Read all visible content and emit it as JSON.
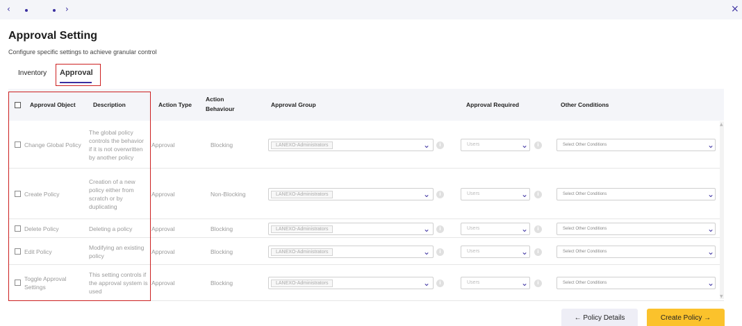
{
  "nav": {
    "prev": "‹",
    "next": "›",
    "close": "×"
  },
  "header": {
    "title": "Approval Setting",
    "subtitle": "Configure specific settings to achieve granular control"
  },
  "tabs": [
    {
      "label": "Inventory"
    },
    {
      "label": "Approval"
    }
  ],
  "table": {
    "headers": {
      "object": "Approval Object",
      "description": "Description",
      "action_type": "Action Type",
      "action_behaviour_1": "Action",
      "action_behaviour_2": "Behaviour",
      "approval_group": "Approval Group",
      "approval_required": "Approval Required",
      "other_conditions": "Other Conditions"
    },
    "rows": [
      {
        "object": [
          "Change Global Policy"
        ],
        "description": [
          "The global policy",
          "controls the behavior",
          "if it is not overwritten",
          "by another policy"
        ],
        "action_type": "Approval",
        "behaviour": "Blocking",
        "group": "LANEXO-Administrators",
        "required": "Users",
        "conditions": "Select Other Conditions"
      },
      {
        "object": [
          "Create Policy"
        ],
        "description": [
          "Creation of a new",
          "policy either from",
          "scratch or by",
          "duplicating"
        ],
        "action_type": "Approval",
        "behaviour": "Non-Blocking",
        "group": "LANEXO-Administrators",
        "required": "Users",
        "conditions": "Select Other Conditions"
      },
      {
        "object": [
          "Delete Policy"
        ],
        "description": [
          "Deleting a policy"
        ],
        "action_type": "Approval",
        "behaviour": "Blocking",
        "group": "LANEXO-Administrators",
        "required": "Users",
        "conditions": "Select Other Conditions"
      },
      {
        "object": [
          "Edit Policy"
        ],
        "description": [
          "Modifying an existing",
          "policy"
        ],
        "action_type": "Approval",
        "behaviour": "Blocking",
        "group": "LANEXO-Administrators",
        "required": "Users",
        "conditions": "Select Other Conditions"
      },
      {
        "object": [
          "Toggle Approval",
          "Settings"
        ],
        "description": [
          "This setting controls if",
          "the approval system is",
          "used"
        ],
        "action_type": "Approval",
        "behaviour": "Blocking",
        "group": "LANEXO-Administrators",
        "required": "Users",
        "conditions": "Select Other Conditions"
      }
    ]
  },
  "footer": {
    "details_label": "← Policy Details",
    "create_label": "Create Policy →"
  },
  "icons": {
    "chevron": "chevron-down-icon",
    "info": "info-icon",
    "checkbox": "checkbox-icon"
  },
  "colors": {
    "accent": "#3a2fa0",
    "highlight": "#cc1f1f",
    "primary_button": "#fbc22c"
  }
}
